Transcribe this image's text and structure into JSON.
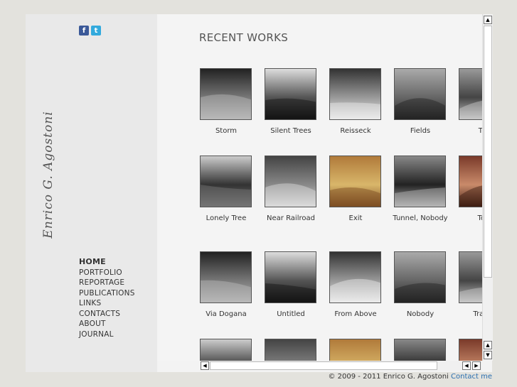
{
  "social": {
    "facebook": "f",
    "twitter": "t"
  },
  "signature": "Enrico G. Agostoni",
  "nav": [
    "HOME",
    "PORTFOLIO",
    "REPORTAGE",
    "PUBLICATIONS",
    "LINKS",
    "CONTACTS",
    "ABOUT",
    "JOURNAL"
  ],
  "section_title": "RECENT WORKS",
  "works": [
    [
      "Storm",
      "Silent Trees",
      "Reisseck",
      "Fields",
      "The"
    ],
    [
      "Lonely Tree",
      "Near Railroad",
      "Exit",
      "Tunnel, Nobody",
      "Tour"
    ],
    [
      "Via Dogana",
      "Untitled",
      "From Above",
      "Nobody",
      "Train a"
    ],
    [
      "",
      "",
      "",
      "",
      ""
    ]
  ],
  "footer": {
    "copyright": "© 2009 - 2011 Enrico G. Agostoni",
    "contact": "Contact me"
  }
}
